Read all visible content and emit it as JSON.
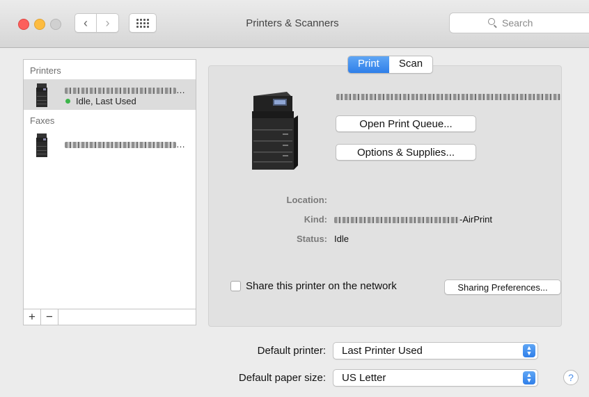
{
  "window": {
    "title": "Printers & Scanners"
  },
  "search": {
    "placeholder": "Search"
  },
  "list": {
    "sections": [
      {
        "header": "Printers",
        "items": [
          {
            "status": "Idle, Last Used",
            "selected": true
          }
        ]
      },
      {
        "header": "Faxes",
        "items": [
          {
            "status": "",
            "selected": false
          }
        ]
      }
    ],
    "add_label": "+",
    "remove_label": "−"
  },
  "tabs": [
    {
      "label": "Print",
      "active": true
    },
    {
      "label": "Scan",
      "active": false
    }
  ],
  "detail": {
    "open_queue_label": "Open Print Queue...",
    "options_label": "Options & Supplies...",
    "location_label": "Location:",
    "location_value": "",
    "kind_label": "Kind:",
    "kind_suffix": "-AirPrint",
    "status_label": "Status:",
    "status_value": "Idle",
    "share_label": "Share this printer on the network",
    "share_checked": false,
    "sharing_prefs_label": "Sharing Preferences..."
  },
  "defaults": {
    "printer_label": "Default printer:",
    "printer_value": "Last Printer Used",
    "paper_label": "Default paper size:",
    "paper_value": "US Letter"
  },
  "help_label": "?",
  "colors": {
    "accent": "#2f7fe9",
    "status_green": "#3cb54a"
  }
}
